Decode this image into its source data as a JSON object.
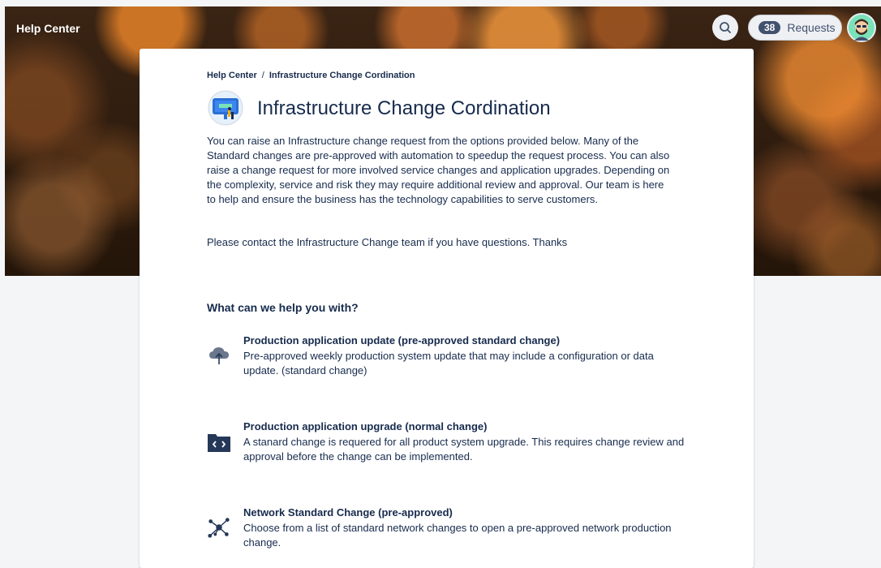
{
  "header": {
    "help_center_label": "Help Center",
    "requests_count": "38",
    "requests_label": "Requests",
    "search_icon": "search-icon",
    "avatar_icon": "avatar"
  },
  "breadcrumb": {
    "home": "Help Center",
    "separator": "/",
    "current": "Infrastructure Change Cordination"
  },
  "portal": {
    "title": "Infrastructure Change Cordination",
    "icon": "portal-icon",
    "description": "You can raise an Infrastructure change request from the options provided below. Many of the Standard changes are pre-approved with automation to speedup the request process. You can also raise a change request for more involved service changes and application upgrades. Depending on the complexity, service and risk they may require additional review and approval. Our team is here to help and ensure the business has the technology capabilities to serve customers.",
    "contact": "Please contact the Infrastructure Change team if you have questions. Thanks"
  },
  "help_section": {
    "heading": "What can we help you with?",
    "request_types": [
      {
        "icon": "cloud-upload-icon",
        "title": "Production application update (pre-approved standard change)",
        "description": "Pre-approved weekly production system update that may include a configuration or data update. (standard change)"
      },
      {
        "icon": "code-folder-icon",
        "title": "Production application upgrade (normal change)",
        "description": "A stanard change is requered for all product system upgrade. This requires change review and approval before the change can be implemented."
      },
      {
        "icon": "network-icon",
        "title": "Network Standard Change (pre-approved)",
        "description": "Choose from a list of standard network changes to open a pre-approved network production change."
      }
    ]
  },
  "colors": {
    "text": "#172b4d",
    "page_bg": "#f4f5f7",
    "icon_gray": "#42526e"
  }
}
